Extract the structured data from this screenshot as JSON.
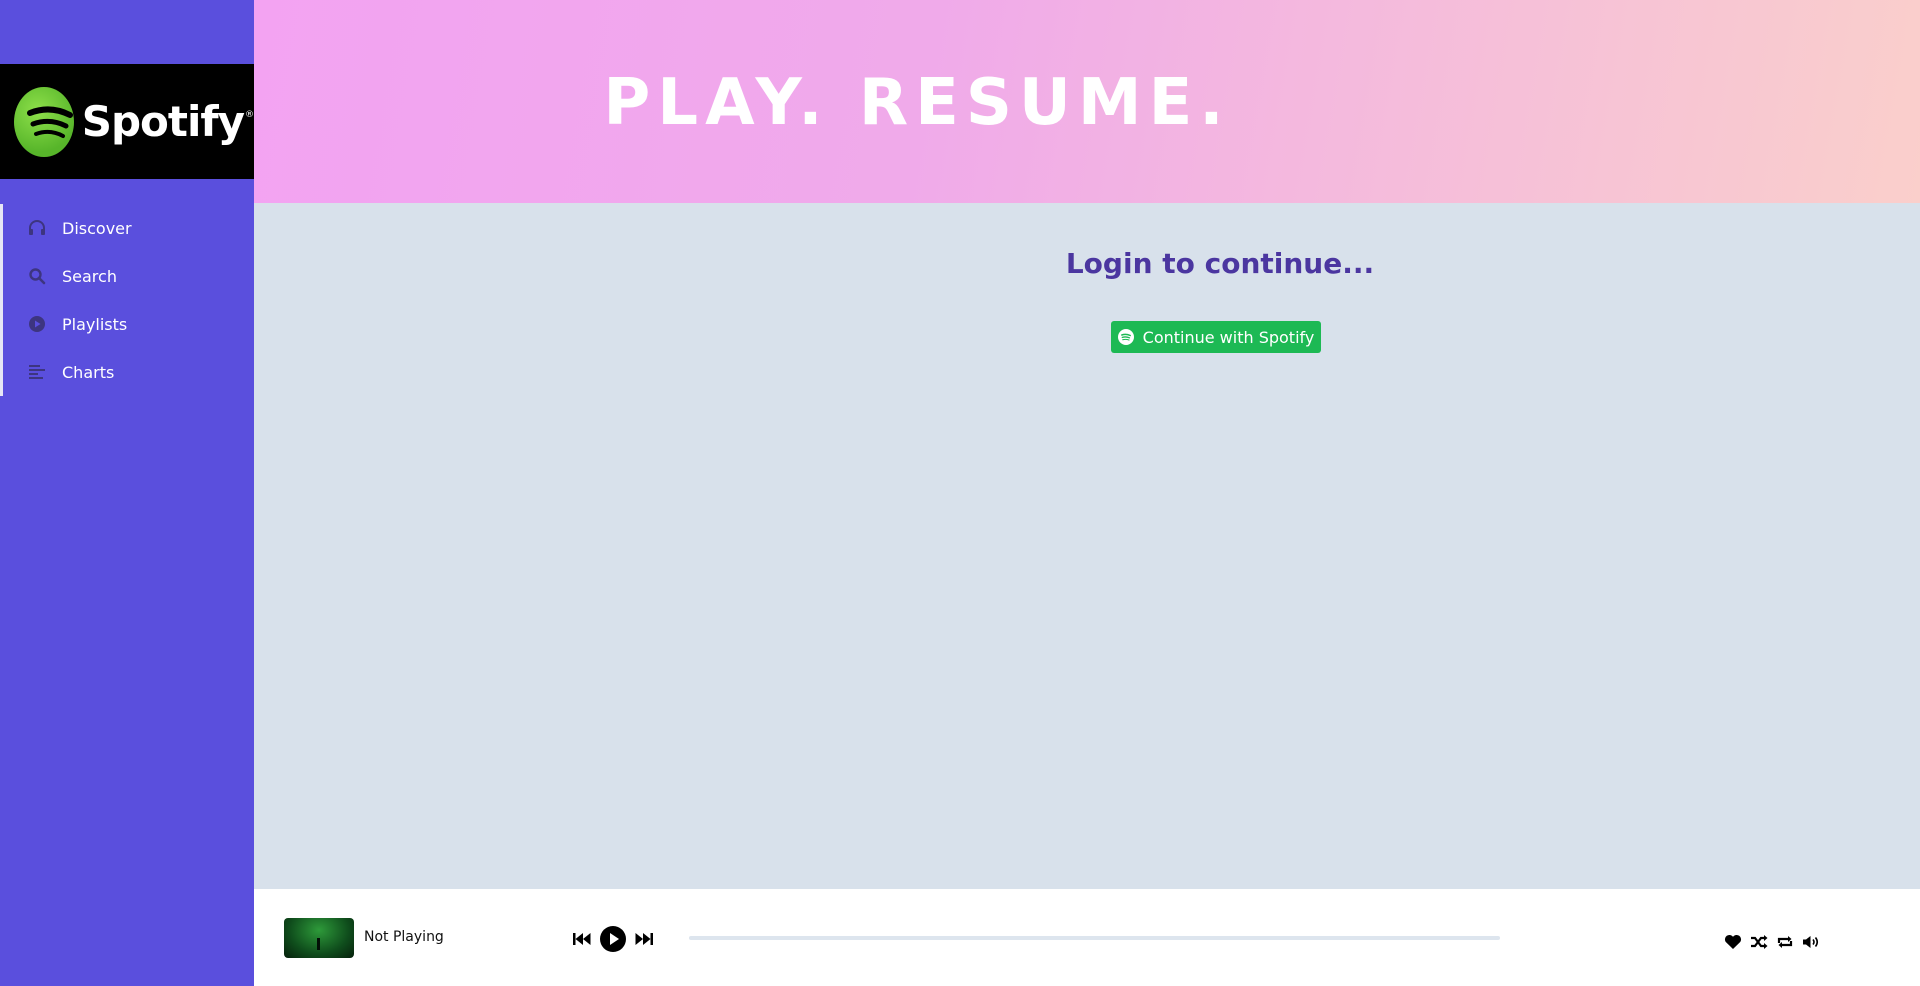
{
  "sidebar": {
    "logo": {
      "text": "Spotify",
      "reg_mark": "®",
      "icon": "spotify-logo-icon",
      "brand_color": "#57b52a"
    },
    "items": [
      {
        "label": "Discover",
        "icon": "headphones-icon"
      },
      {
        "label": "Search",
        "icon": "search-icon"
      },
      {
        "label": "Playlists",
        "icon": "play-circle-icon"
      },
      {
        "label": "Charts",
        "icon": "bars-icon"
      }
    ],
    "background": "#5a4fdd"
  },
  "header": {
    "title": "PLAY. RESUME."
  },
  "main": {
    "login_title": "Login to continue...",
    "login_button": {
      "label": "Continue with Spotify",
      "icon": "spotify-icon",
      "color": "#1db954"
    }
  },
  "player": {
    "track_title": "Not Playing",
    "progress": 0,
    "controls": [
      "previous-icon",
      "play-icon",
      "next-icon"
    ],
    "actions": [
      "heart-icon",
      "shuffle-icon",
      "repeat-icon",
      "volume-icon"
    ]
  }
}
